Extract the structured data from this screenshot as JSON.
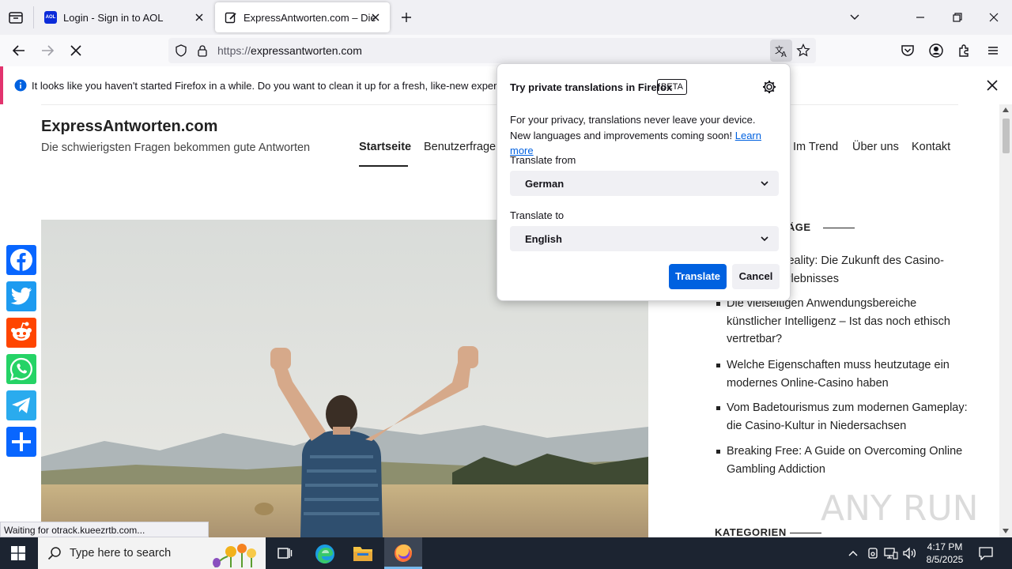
{
  "browser": {
    "tabs": [
      {
        "title": "Login - Sign in to AOL",
        "favicon": "aol-icon",
        "active": false
      },
      {
        "title": "ExpressAntworten.com – Die schw",
        "favicon": "edit-icon",
        "active": true
      }
    ],
    "url": {
      "scheme": "https://",
      "host": "expressantworten.com"
    },
    "notification": "It looks like you haven't started Firefox in a while. Do you want to clean it up for a fresh, like-new experience? A",
    "status": "Waiting for otrack.kueezrtb.com..."
  },
  "site": {
    "title": "ExpressAntworten.com",
    "tagline": "Die schwierigsten Fragen bekommen gute Antworten",
    "menu": [
      "Startseite",
      "Benutzerfragen",
      "Im Trend",
      "Über uns",
      "Kontakt"
    ],
    "sidebar_heading": "RÄGE",
    "posts": [
      "Reality: Die Zukunft des Casino-Erlebnisses",
      "Die vielseitigen Anwendungsbereiche künstlicher Intelligenz – Ist das noch ethisch vertretbar?",
      "Welche Eigenschaften muss heutzutage ein modernes Online-Casino haben",
      "Vom Badetourismus zum modernen Gameplay: die Casino-Kultur in Niedersachsen",
      "Breaking Free: A Guide on Overcoming Online Gambling Addiction"
    ],
    "categories_heading": "KATEGORIEN"
  },
  "translation_panel": {
    "title": "Try private translations in Firefox",
    "badge": "BETA",
    "description": "For your privacy, translations never leave your device. New languages and improvements coming soon!",
    "learn_more": "Learn more",
    "from_label": "Translate from",
    "from_value": "German",
    "to_label": "Translate to",
    "to_value": "English",
    "translate_button": "Translate",
    "cancel_button": "Cancel"
  },
  "taskbar": {
    "search_placeholder": "Type here to search",
    "time": "4:17 PM",
    "date": "8/5/2025"
  },
  "watermark": "ANY RUN",
  "colors": {
    "accent": "#0061e0",
    "notice_accent": "#e2346e",
    "taskbar": "#1c2431"
  }
}
